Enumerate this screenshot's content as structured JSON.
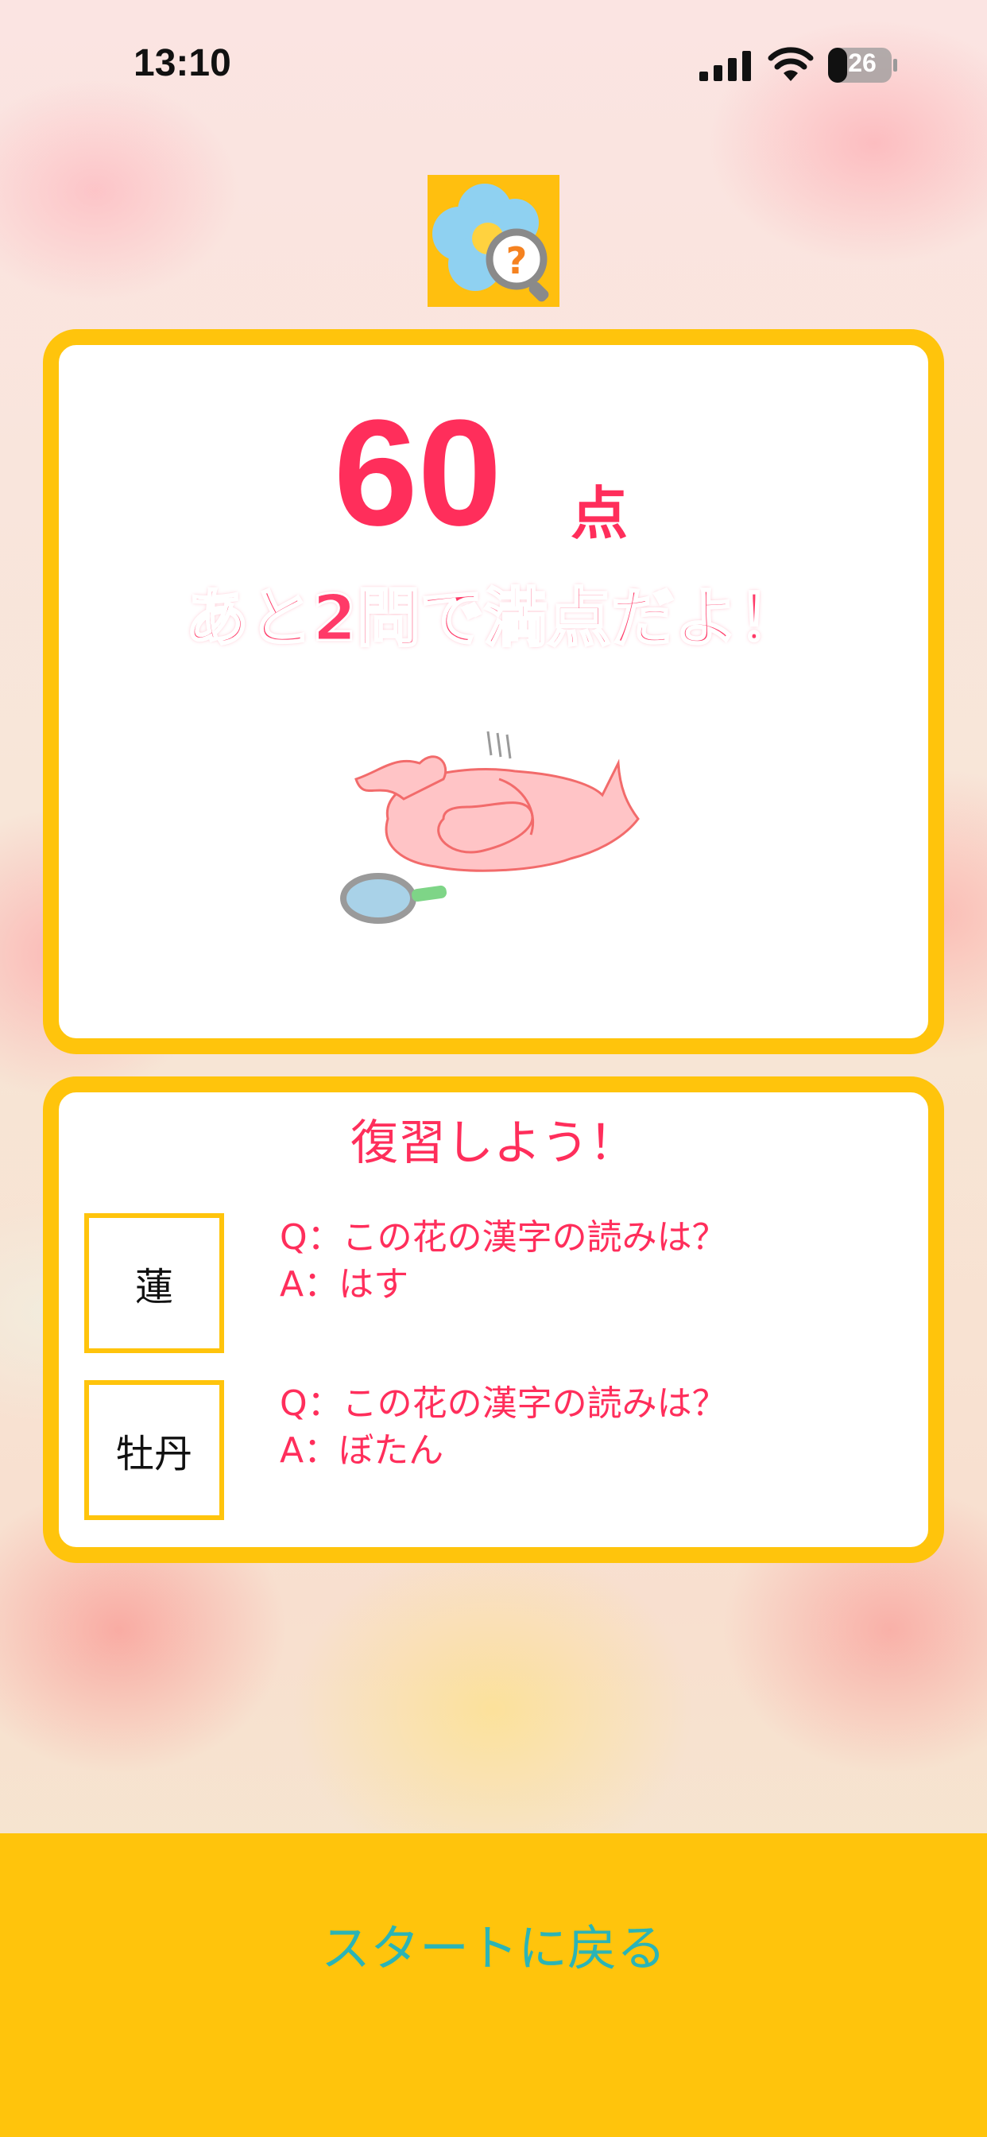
{
  "status_bar": {
    "time": "13:10",
    "battery": "26"
  },
  "result": {
    "score": "60",
    "unit": "点",
    "message": "あと2問で満点だよ！"
  },
  "review": {
    "title": "復習しよう！",
    "items": [
      {
        "kanji": "蓮",
        "question": "Q：この花の漢字の読みは？",
        "answer": "A：はす"
      },
      {
        "kanji": "牡丹",
        "question": "Q：この花の漢字の読みは？",
        "answer": "A：ぼたん"
      }
    ]
  },
  "footer": {
    "back_label": "スタートに戻る"
  },
  "colors": {
    "accent_yellow": "#ffc40c",
    "score_pink": "#ff2e5b",
    "button_teal": "#2bb4b6"
  },
  "icons": [
    "signal-icon",
    "wifi-icon",
    "battery-icon",
    "app-logo-icon",
    "sleeping-character-illustration"
  ]
}
